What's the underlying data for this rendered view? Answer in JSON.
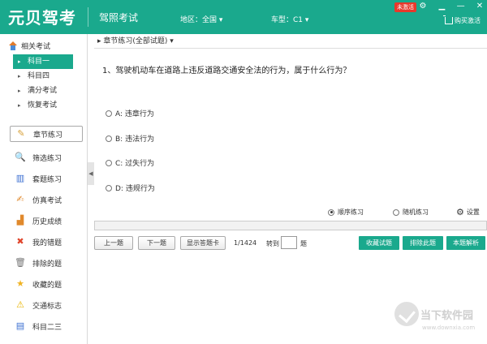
{
  "header": {
    "app_name": "元贝驾考",
    "subtitle": "驾照考试",
    "region": "地区：全国 ▾",
    "car_type": "车型：C1 ▾",
    "badge": "未激活",
    "buy_label": "购买激活",
    "window_controls": [
      "⚙",
      "▁",
      "—",
      "✕"
    ]
  },
  "sidebar": {
    "related_label": "相关考试",
    "sub_items": [
      {
        "label": "科目一",
        "active": true
      },
      {
        "label": "科目四",
        "active": false
      },
      {
        "label": "满分考试",
        "active": false
      },
      {
        "label": "恢复考试",
        "active": false
      }
    ],
    "nav": [
      {
        "label": "章节练习",
        "icon": "pencil-icon",
        "glyph": "✎",
        "color": "#d8a13a"
      },
      {
        "label": "筛选练习",
        "icon": "search-icon",
        "glyph": "🔍",
        "color": "#555555"
      },
      {
        "label": "套题练习",
        "icon": "books-icon",
        "glyph": "▥",
        "color": "#3b6fd1"
      },
      {
        "label": "仿真考试",
        "icon": "exam-icon",
        "glyph": "✍",
        "color": "#e0892c"
      },
      {
        "label": "历史成绩",
        "icon": "bar-chart-icon",
        "glyph": "▟",
        "color": "#e0892c"
      },
      {
        "label": "我的错题",
        "icon": "wrong-icon",
        "glyph": "✖",
        "color": "#e0462c"
      },
      {
        "label": "排除的题",
        "icon": "trash-icon",
        "glyph": "🗑",
        "color": "#777777"
      },
      {
        "label": "收藏的题",
        "icon": "star-icon",
        "glyph": "★",
        "color": "#f0b323"
      },
      {
        "label": "交通标志",
        "icon": "warning-icon",
        "glyph": "⚠",
        "color": "#e8b400"
      },
      {
        "label": "科目二三",
        "icon": "book-icon",
        "glyph": "▤",
        "color": "#3b6fd1"
      }
    ]
  },
  "main": {
    "breadcrumb": "▸ 章节练习(全部试题) ▾",
    "question": "1、驾驶机动车在道路上违反道路交通安全法的行为，属于什么行为？",
    "options": [
      "A: 违章行为",
      "B: 违法行为",
      "C: 过失行为",
      "D: 违规行为"
    ],
    "modes": {
      "sequential": "顺序练习",
      "random": "随机练习",
      "settings": "设置",
      "selected": "sequential"
    },
    "progress": 0.0,
    "buttons": {
      "prev": "上一题",
      "next": "下一题",
      "show_card": "显示答题卡",
      "counter": "1/1424",
      "goto": "转到",
      "goto_value": "",
      "ti": "题",
      "favorite": "收藏试题",
      "exclude": "排除此题",
      "explain": "本题解析"
    }
  },
  "watermark": {
    "text": "当下软件园",
    "url": "www.downxia.com"
  }
}
